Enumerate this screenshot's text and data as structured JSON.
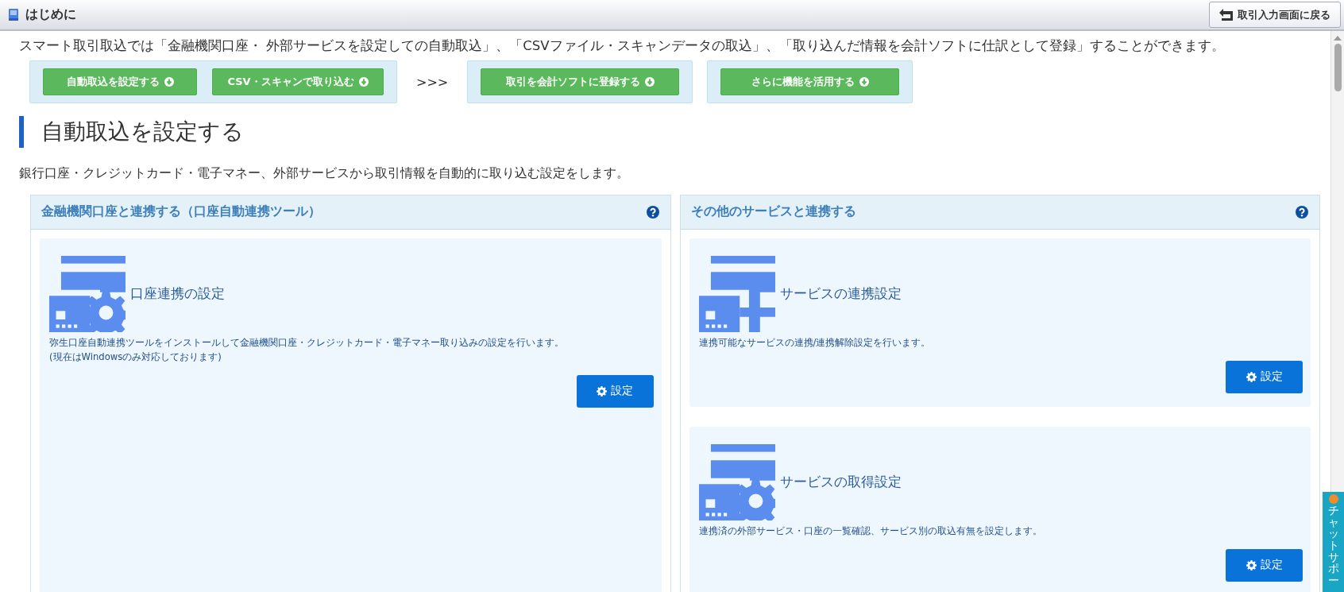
{
  "header": {
    "title": "はじめに",
    "back_button": "取引入力画面に戻る"
  },
  "intro": "スマート取引取込では「金融機関口座・ 外部サービスを設定しての自動取込」、「CSVファイル・スキャンデータの取込」、「取り込んだ情報を会計ソフトに仕訳として登録」することができます。",
  "nav": [
    {
      "kind": "group",
      "buttons": [
        "自動取込を設定する",
        "CSV・スキャンで取り込む"
      ]
    },
    {
      "kind": "text",
      "text": ">>>"
    },
    {
      "kind": "group",
      "buttons": [
        "取引を会計ソフトに登録する"
      ]
    },
    {
      "kind": "group",
      "buttons": [
        "さらに機能を活用する"
      ]
    }
  ],
  "section": {
    "heading": "自動取込を設定する",
    "description": "銀行口座・クレジットカード・電子マネー、外部サービスから取引情報を自動的に取り込む設定をします。"
  },
  "panels": [
    {
      "title": "金融機関口座と連携する（口座自動連携ツール）",
      "cards": [
        {
          "kind": "gear",
          "title": "口座連携の設定",
          "description": [
            "弥生口座自動連携ツールをインストールして金融機関口座・クレジットカード・電子マネー取り込みの設定を行います。",
            "(現在はWindowsのみ対応しております)"
          ],
          "button": "設定"
        }
      ]
    },
    {
      "title": "その他のサービスと連携する",
      "cards": [
        {
          "kind": "plus",
          "title": "サービスの連携設定",
          "description": [
            "連携可能なサービスの連携/連携解除設定を行います。"
          ],
          "button": "設定"
        },
        {
          "kind": "gear",
          "title": "サービスの取得設定",
          "description": [
            "連携済の外部サービス・口座の一覧確認、サービス別の取込有無を設定します。"
          ],
          "button": "設定"
        }
      ]
    }
  ],
  "chat_tab": {
    "text": "チャットサポー"
  }
}
